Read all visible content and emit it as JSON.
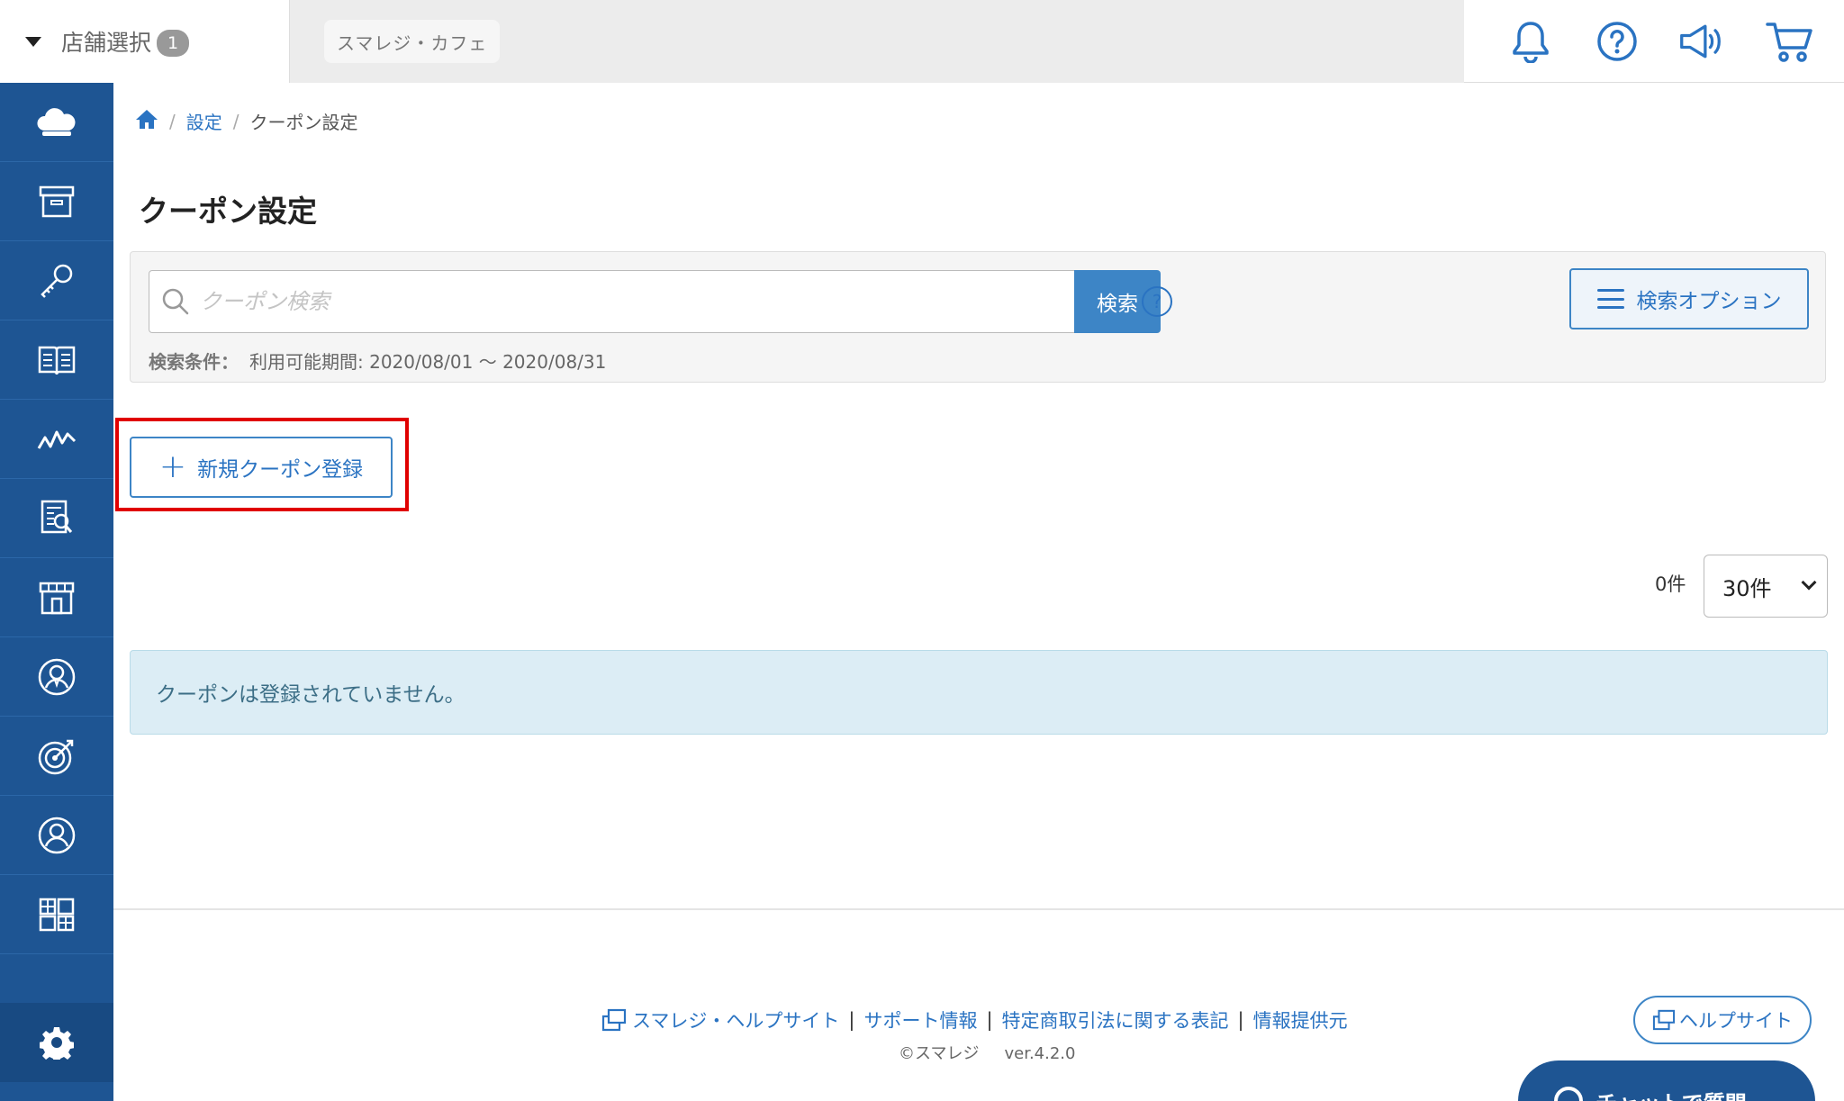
{
  "topbar": {
    "store_select_label": "店舗選択",
    "store_badge": "1",
    "store_name": "スマレジ・カフェ",
    "icons": [
      "bell-icon",
      "help-icon",
      "megaphone-icon",
      "cart-icon"
    ]
  },
  "sidebar": {
    "items": [
      "cloud-icon",
      "archive-icon",
      "key-icon",
      "book-icon",
      "chart-icon",
      "report-icon",
      "store-icon",
      "customer-icon",
      "target-icon",
      "user-icon",
      "grid-icon"
    ],
    "bottom": "gear-icon"
  },
  "breadcrumb": {
    "home": "home-icon",
    "settings": "設定",
    "current": "クーポン設定"
  },
  "page": {
    "title": "クーポン設定"
  },
  "search": {
    "placeholder": "クーポン検索",
    "button": "検索",
    "help": "?",
    "options_button": "検索オプション",
    "condition_label": "検索条件：",
    "condition_value": "利用可能期間: 2020/08/01 〜 2020/08/31"
  },
  "actions": {
    "new_coupon": "新規クーポン登録"
  },
  "list": {
    "count": "0件",
    "per_page": "30件",
    "empty_message": "クーポンは登録されていません。"
  },
  "footer": {
    "links": [
      "スマレジ・ヘルプサイト",
      "サポート情報",
      "特定商取引法に関する表記",
      "情報提供元"
    ],
    "copyright": "©スマレジ",
    "version": "ver.4.2.0",
    "help_site_button": "ヘルプサイト",
    "chat_button": "チャットで質問"
  },
  "colors": {
    "sidebar": "#1e5593",
    "accent": "#3d85c6",
    "link": "#2a73c2",
    "highlight": "#e00000",
    "info_bg": "#dcedf5"
  }
}
